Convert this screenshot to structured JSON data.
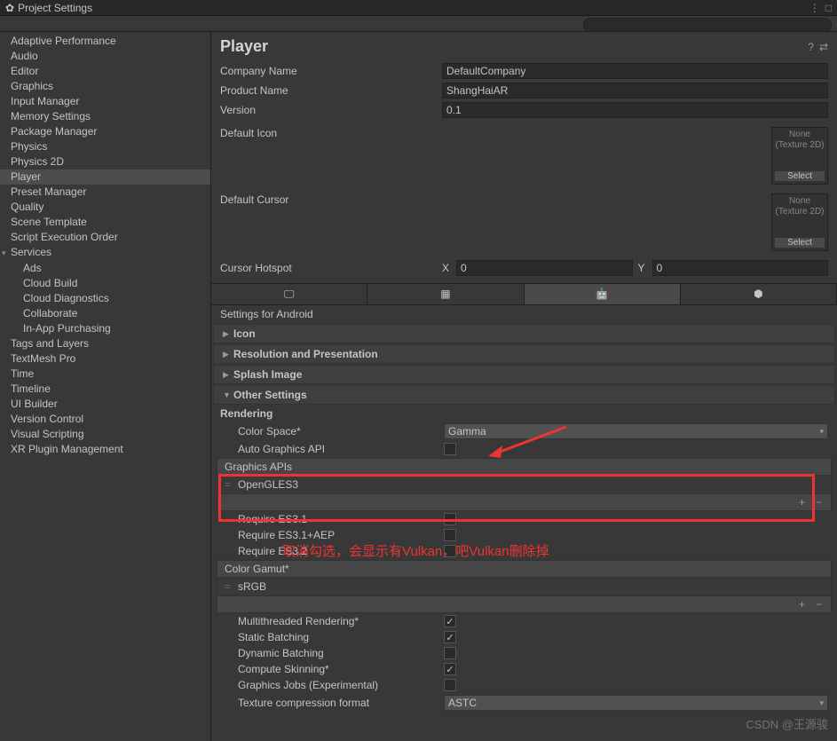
{
  "window": {
    "title": "Project Settings"
  },
  "search": {
    "placeholder": ""
  },
  "sidebar": {
    "items": [
      {
        "label": "Adaptive Performance"
      },
      {
        "label": "Audio"
      },
      {
        "label": "Editor"
      },
      {
        "label": "Graphics"
      },
      {
        "label": "Input Manager"
      },
      {
        "label": "Memory Settings"
      },
      {
        "label": "Package Manager"
      },
      {
        "label": "Physics"
      },
      {
        "label": "Physics 2D"
      },
      {
        "label": "Player",
        "selected": true
      },
      {
        "label": "Preset Manager"
      },
      {
        "label": "Quality"
      },
      {
        "label": "Scene Template"
      },
      {
        "label": "Script Execution Order"
      },
      {
        "label": "Services",
        "expandable": true
      },
      {
        "label": "Ads",
        "child": true
      },
      {
        "label": "Cloud Build",
        "child": true
      },
      {
        "label": "Cloud Diagnostics",
        "child": true
      },
      {
        "label": "Collaborate",
        "child": true
      },
      {
        "label": "In-App Purchasing",
        "child": true
      },
      {
        "label": "Tags and Layers"
      },
      {
        "label": "TextMesh Pro"
      },
      {
        "label": "Time"
      },
      {
        "label": "Timeline"
      },
      {
        "label": "UI Builder"
      },
      {
        "label": "Version Control"
      },
      {
        "label": "Visual Scripting"
      },
      {
        "label": "XR Plugin Management"
      }
    ]
  },
  "player": {
    "title": "Player",
    "companyNameLabel": "Company Name",
    "companyName": "DefaultCompany",
    "productNameLabel": "Product Name",
    "productName": "ShangHaiAR",
    "versionLabel": "Version",
    "version": "0.1",
    "defaultIconLabel": "Default Icon",
    "defaultCursorLabel": "Default Cursor",
    "thumbNone": "None",
    "thumbType": "(Texture 2D)",
    "selectBtn": "Select",
    "cursorHotspotLabel": "Cursor Hotspot",
    "hotspotX": "0",
    "hotspotY": "0",
    "settingsFor": "Settings for Android",
    "foldouts": {
      "icon": "Icon",
      "resolution": "Resolution and Presentation",
      "splash": "Splash Image",
      "other": "Other Settings"
    },
    "rendering": {
      "header": "Rendering",
      "colorSpaceLabel": "Color Space*",
      "colorSpace": "Gamma",
      "autoGraphicsLabel": "Auto Graphics API",
      "graphicsApisLabel": "Graphics APIs",
      "graphicsApis": [
        "OpenGLES3"
      ],
      "requireES31": "Require ES3.1",
      "requireES31AEP": "Require ES3.1+AEP",
      "requireES32": "Require ES3.2",
      "colorGamutLabel": "Color Gamut*",
      "colorGamut": [
        "sRGB"
      ],
      "multithreadedLabel": "Multithreaded Rendering*",
      "staticBatchingLabel": "Static Batching",
      "dynamicBatchingLabel": "Dynamic Batching",
      "computeSkinningLabel": "Compute Skinning*",
      "graphicsJobsLabel": "Graphics Jobs (Experimental)",
      "textureCompressionLabel": "Texture compression format",
      "textureCompression": "ASTC"
    }
  },
  "annotations": {
    "redText": "取消勾选，会显示有Vulkan，吧Vulkan删除掉"
  },
  "watermark": "CSDN @王源骏"
}
